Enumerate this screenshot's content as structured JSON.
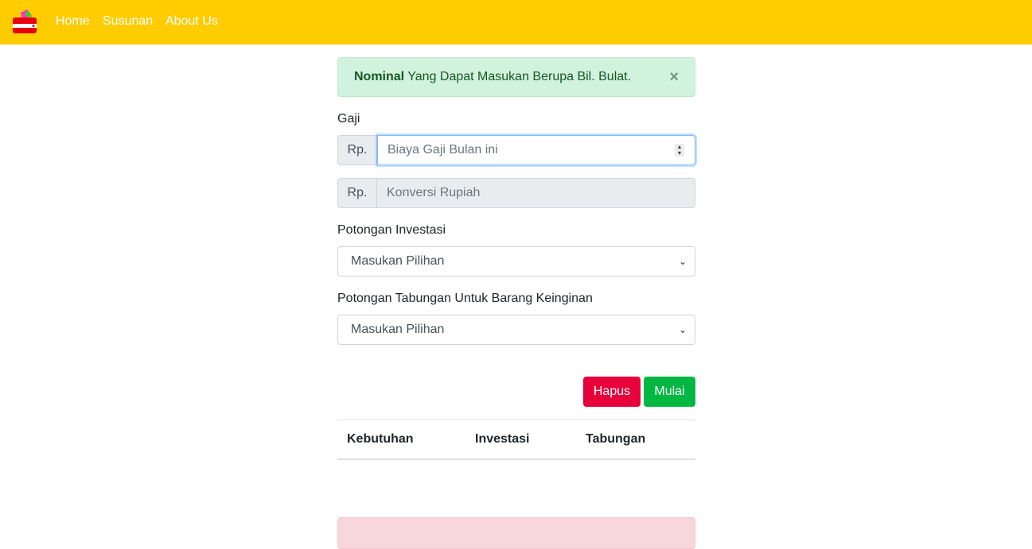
{
  "nav": {
    "brand_icon": "wallet-icon",
    "links": [
      "Home",
      "Susunan",
      "About Us"
    ]
  },
  "alert": {
    "bold": "Nominal",
    "text": " Yang Dapat Masukan Berupa Bil. Bulat.",
    "close": "×"
  },
  "form": {
    "gaji_label": "Gaji",
    "currency_prefix": "Rp.",
    "gaji_placeholder": "Biaya Gaji Bulan ini",
    "konversi_placeholder": "Konversi Rupiah",
    "investasi_label": "Potongan Investasi",
    "investasi_selected": "Masukan Pilihan",
    "tabungan_label": "Potongan Tabungan Untuk Barang Keinginan",
    "tabungan_selected": "Masukan Pilihan"
  },
  "buttons": {
    "hapus": "Hapus",
    "mulai": "Mulai"
  },
  "table": {
    "headers": [
      "Kebutuhan",
      "Investasi",
      "Tabungan"
    ]
  },
  "colors": {
    "navbar": "#ffcc00",
    "danger": "#e8003d",
    "success": "#00b841"
  }
}
